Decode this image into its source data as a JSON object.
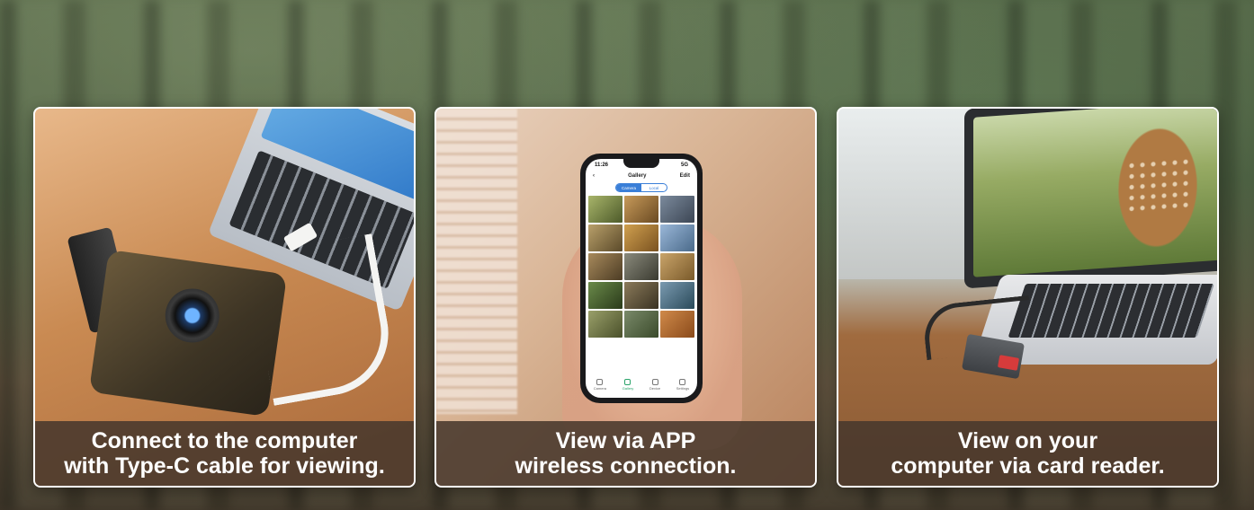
{
  "cards": [
    {
      "caption_line1": "Connect to the computer",
      "caption_line2": "with Type-C cable for viewing."
    },
    {
      "caption_line1": "View via APP",
      "caption_line2": "wireless connection.",
      "phone": {
        "time": "11:26",
        "signal": "5G",
        "title": "Gallery",
        "action": "Edit",
        "segment_selected": "Camera",
        "segment_other": "Local",
        "tabs": [
          "Camera",
          "Gallery",
          "Device",
          "Settings"
        ]
      }
    },
    {
      "caption_line1": "View on your",
      "caption_line2": "computer via card reader."
    }
  ],
  "colors": {
    "caption_bg": "#48382c",
    "caption_text": "#ffffff",
    "card_border": "#ffffff",
    "app_accent": "#3a7fd8"
  }
}
